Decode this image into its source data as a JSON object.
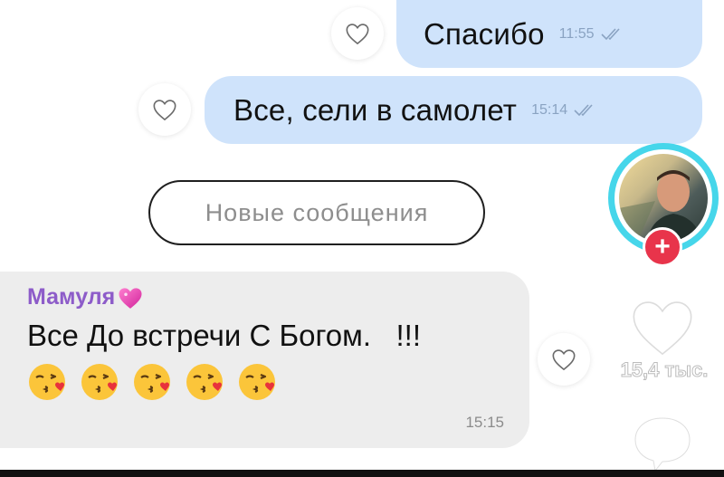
{
  "messages": {
    "out1": {
      "text": "Спасибо",
      "time": "11:55"
    },
    "out2": {
      "text": "Все, сели в самолет",
      "time": "15:14"
    },
    "separator": "Новые сообщения",
    "incoming": {
      "sender": "Мамуля",
      "text": "Все До встречи С Богом.   !!!",
      "emojis": [
        "kissing-face-with-heart",
        "kissing-face-with-heart",
        "kissing-face-with-heart",
        "kissing-face-with-heart",
        "kissing-face-with-heart"
      ],
      "time": "15:15"
    }
  },
  "overlay": {
    "like_count": "15,4 тыс.",
    "follow_symbol": "+"
  },
  "colors": {
    "outgoing_bubble": "#cfe3fb",
    "incoming_bubble": "#ededed",
    "sender_name": "#8d5cc9",
    "avatar_ring": "#46d6ea",
    "follow_button": "#e8344b"
  }
}
